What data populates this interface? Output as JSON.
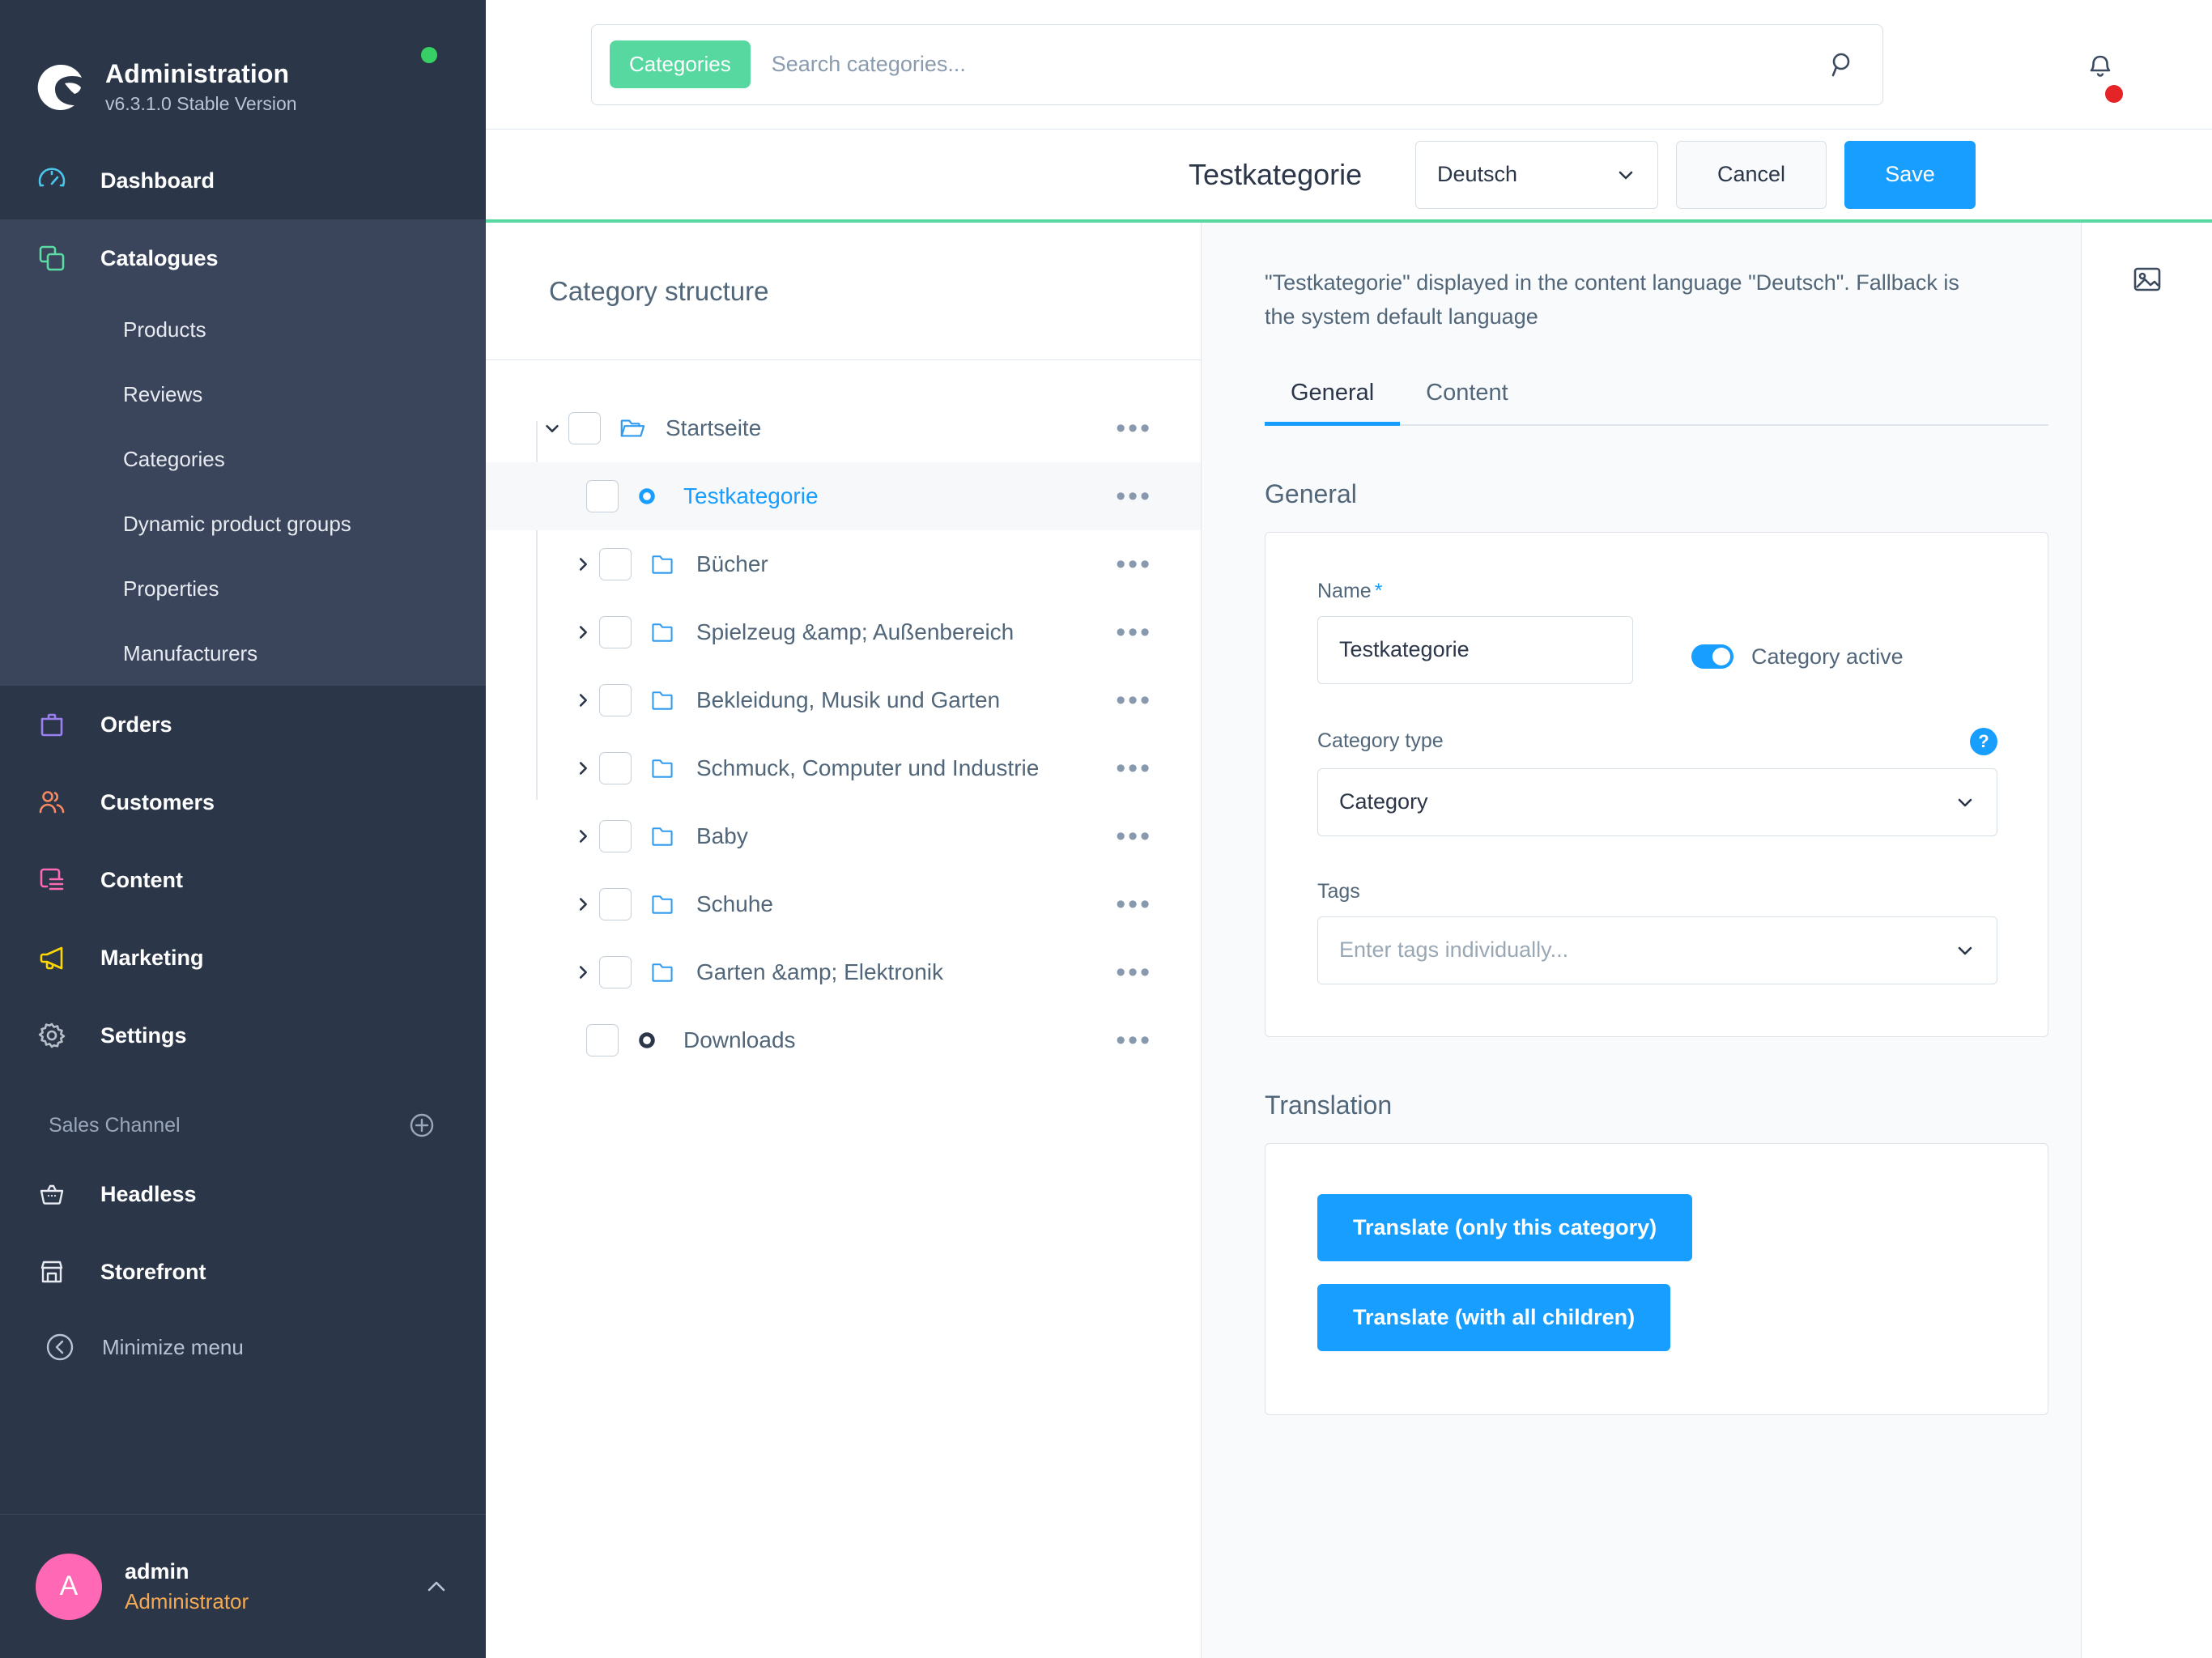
{
  "sidebar": {
    "brand": {
      "title": "Administration",
      "version": "v6.3.1.0 Stable Version",
      "status_color": "#37d064"
    },
    "nav": [
      {
        "label": "Dashboard",
        "icon": "gauge-icon",
        "color": "#4bc7ec",
        "active_bg": false
      },
      {
        "label": "Catalogues",
        "icon": "catalogue-icon",
        "color": "#5ddba4",
        "active_bg": true
      }
    ],
    "catalogue_children": [
      {
        "label": "Products"
      },
      {
        "label": "Reviews"
      },
      {
        "label": "Categories"
      },
      {
        "label": "Dynamic product groups"
      },
      {
        "label": "Properties"
      },
      {
        "label": "Manufacturers"
      }
    ],
    "nav_rest": [
      {
        "label": "Orders",
        "icon": "bag-icon",
        "color": "#9a7ff0"
      },
      {
        "label": "Customers",
        "icon": "users-icon",
        "color": "#f88962"
      },
      {
        "label": "Content",
        "icon": "content-icon",
        "color": "#ff68b4"
      },
      {
        "label": "Marketing",
        "icon": "megaphone-icon",
        "color": "#ffd700"
      },
      {
        "label": "Settings",
        "icon": "gear-icon",
        "color": "#b6bfca"
      }
    ],
    "sales_channel": {
      "label": "Sales Channel",
      "items": [
        {
          "label": "Headless",
          "icon": "basket-icon"
        },
        {
          "label": "Storefront",
          "icon": "store-icon"
        }
      ]
    },
    "minimize_label": "Minimize menu",
    "user": {
      "initial": "A",
      "name": "admin",
      "role": "Administrator",
      "avatar_color": "#ff68b4"
    }
  },
  "topbar": {
    "search": {
      "tag": "Categories",
      "placeholder": "Search categories...",
      "value": "",
      "tag_color": "#56d8a0"
    },
    "notifications_icon": "bell-icon",
    "notification_badge_color": "#e52427"
  },
  "pagehead": {
    "title": "Testkategorie",
    "language_select": "Deutsch",
    "cancel_label": "Cancel",
    "save_label": "Save",
    "save_color": "#189eff",
    "accent_color": "#56d8a0"
  },
  "tree": {
    "heading": "Category structure",
    "rows": [
      {
        "label": "Startseite",
        "depth": 0,
        "caret": "down",
        "icon": "folder-open-icon",
        "selected": false,
        "menu": "more-icon"
      },
      {
        "label": "Testkategorie",
        "depth": 1,
        "caret": "none",
        "icon": "dot-ring-icon",
        "selected": true,
        "menu": "more-icon"
      },
      {
        "label": "Bücher",
        "depth": 1,
        "caret": "right",
        "icon": "folder-icon",
        "selected": false,
        "menu": "more-icon"
      },
      {
        "label": "Spielzeug &amp; Außenbereich",
        "depth": 1,
        "caret": "right",
        "icon": "folder-icon",
        "selected": false,
        "menu": "more-icon"
      },
      {
        "label": "Bekleidung, Musik und Garten",
        "depth": 1,
        "caret": "right",
        "icon": "folder-icon",
        "selected": false,
        "menu": "more-icon"
      },
      {
        "label": "Schmuck, Computer und Industrie",
        "depth": 1,
        "caret": "right",
        "icon": "folder-icon",
        "selected": false,
        "menu": "more-icon"
      },
      {
        "label": "Baby",
        "depth": 1,
        "caret": "right",
        "icon": "folder-icon",
        "selected": false,
        "menu": "more-icon"
      },
      {
        "label": "Schuhe",
        "depth": 1,
        "caret": "right",
        "icon": "folder-icon",
        "selected": false,
        "menu": "more-icon"
      },
      {
        "label": "Garten &amp; Elektronik",
        "depth": 1,
        "caret": "right",
        "icon": "folder-icon",
        "selected": false,
        "menu": "more-icon"
      },
      {
        "label": "Downloads",
        "depth": 1,
        "caret": "none",
        "icon": "dot-ring-dark-icon",
        "selected": false,
        "menu": "more-icon"
      }
    ]
  },
  "detail": {
    "language_note": "\"Testkategorie\" displayed in the content language \"Deutsch\". Fallback is the system default language",
    "tabs": [
      {
        "label": "General",
        "active": true
      },
      {
        "label": "Content",
        "active": false
      }
    ],
    "general": {
      "section_title": "General",
      "name_label": "Name",
      "name_required": "*",
      "name_value": "Testkategorie",
      "active_toggle_label": "Category active",
      "active_toggle_on": true,
      "category_type_label": "Category type",
      "category_type_value": "Category",
      "category_type_help": "?",
      "tags_label": "Tags",
      "tags_placeholder": "Enter tags individually..."
    },
    "translation": {
      "section_title": "Translation",
      "btn_only_this": "Translate (only this category)",
      "btn_with_children": "Translate (with all children)"
    }
  },
  "rail": {
    "media_icon": "image-icon"
  }
}
